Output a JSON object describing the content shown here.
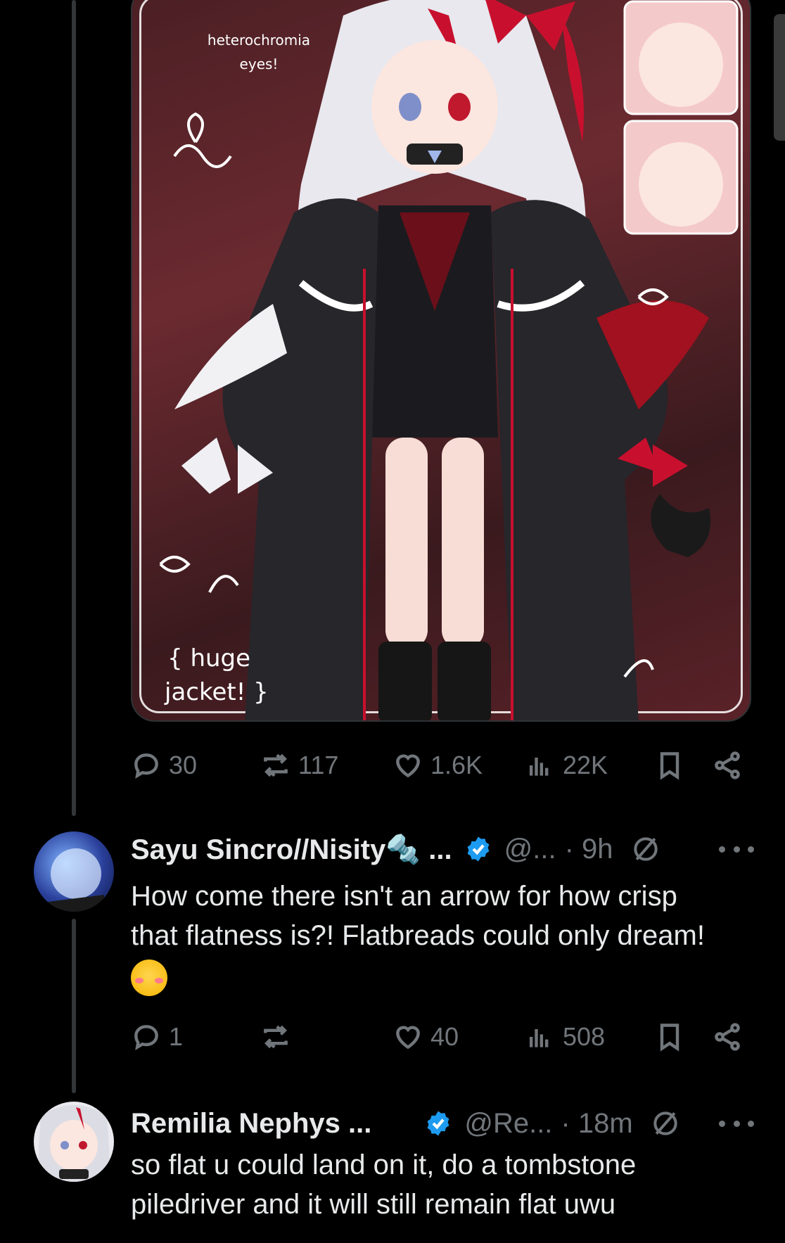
{
  "post": {
    "image_notes": {
      "top_left": "heterochromia\neyes!",
      "bottom_left_line1": "{ huge",
      "bottom_left_line2": "jacket! }"
    },
    "stats": {
      "replies": "30",
      "reposts": "117",
      "likes": "1.6K",
      "views": "22K"
    }
  },
  "replies": [
    {
      "name": "Sayu Sincro//Nisity🔩 ...",
      "handle": "@...",
      "time": "· 9h",
      "text_line1": "How come there isn't an arrow for how crisp",
      "text_line2": "that flatness is?! Flatbreads could only dream!",
      "emoji": "relieved-smiling-face",
      "stats": {
        "replies": "1",
        "reposts": "",
        "likes": "40",
        "views": "508"
      }
    },
    {
      "name": "Remilia Nephys ...",
      "handle": "@Re...",
      "time": "· 18m",
      "text_line1": "so flat u could land on it, do a tombstone",
      "text_line2": "piledriver and it will still remain flat uwu"
    }
  ],
  "colors": {
    "background": "#000000",
    "text": "#e7e9ea",
    "muted": "#71767b",
    "verified": "#1d9bf0",
    "thread_line": "#333639"
  }
}
